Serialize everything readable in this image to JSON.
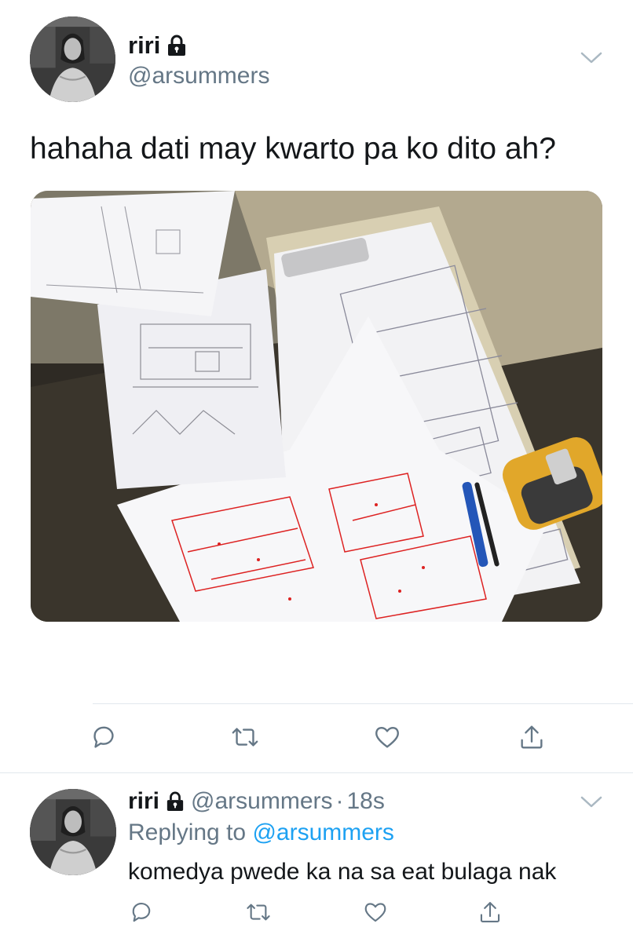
{
  "tweet": {
    "display_name": "riri",
    "handle": "@arsummers",
    "text": "hahaha dati may kwarto pa ko dito ah?",
    "media_description_icon": "blueprint-photo",
    "actions": [
      "reply-icon",
      "retweet-icon",
      "like-icon",
      "share-icon"
    ]
  },
  "reply": {
    "display_name": "riri",
    "handle": "@arsummers",
    "separator": "·",
    "time": "18s",
    "replying_prefix": "Replying to",
    "replying_to": "@arsummers",
    "text": "komedya pwede ka na sa eat bulaga nak",
    "actions": [
      "reply-icon",
      "retweet-icon",
      "like-icon",
      "share-icon"
    ]
  },
  "colors": {
    "text_primary": "#14171a",
    "text_secondary": "#657786",
    "link": "#1da1f2",
    "divider": "#e1e8ed",
    "icon": "#657786"
  }
}
